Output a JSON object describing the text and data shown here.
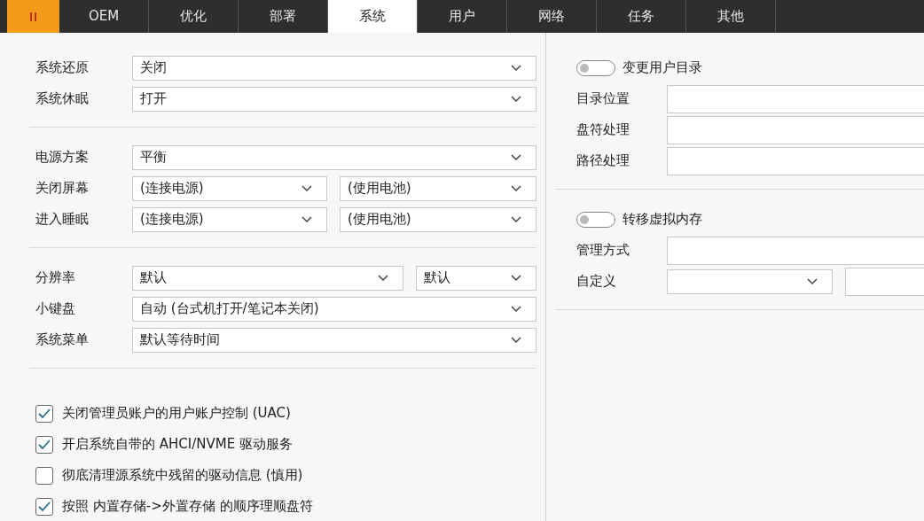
{
  "tabs": [
    {
      "kind": "pause",
      "selected": false
    },
    {
      "kind": "text",
      "label": "OEM",
      "selected": false
    },
    {
      "kind": "text",
      "label": "优化",
      "selected": false
    },
    {
      "kind": "text",
      "label": "部署",
      "selected": false
    },
    {
      "kind": "text",
      "label": "系统",
      "selected": true
    },
    {
      "kind": "text",
      "label": "用户",
      "selected": false
    },
    {
      "kind": "text",
      "label": "网络",
      "selected": false
    },
    {
      "kind": "text",
      "label": "任务",
      "selected": false
    },
    {
      "kind": "text",
      "label": "其他",
      "selected": false
    }
  ],
  "left_sections": [
    {
      "rows": [
        {
          "label": "系统还原",
          "kind": "single",
          "controls": [
            {
              "kind": "select",
              "value": "关闭"
            }
          ]
        },
        {
          "label": "系统休眠",
          "kind": "single",
          "controls": [
            {
              "kind": "select",
              "value": "打开"
            }
          ]
        }
      ]
    },
    {
      "rows": [
        {
          "label": "电源方案",
          "kind": "single",
          "controls": [
            {
              "kind": "select",
              "value": "平衡"
            }
          ]
        },
        {
          "label": "关闭屏幕",
          "kind": "pair",
          "controls": [
            {
              "kind": "select",
              "value": "(连接电源)"
            },
            {
              "kind": "select",
              "value": "(使用电池)"
            }
          ]
        },
        {
          "label": "进入睡眠",
          "kind": "pair",
          "controls": [
            {
              "kind": "select",
              "value": "(连接电源)"
            },
            {
              "kind": "select",
              "value": "(使用电池)"
            }
          ]
        }
      ]
    },
    {
      "rows": [
        {
          "label": "分辨率",
          "kind": "split",
          "controls": [
            {
              "kind": "select",
              "value": "默认"
            },
            {
              "kind": "select",
              "value": "默认"
            }
          ]
        },
        {
          "label": "小键盘",
          "kind": "single",
          "controls": [
            {
              "kind": "select",
              "value": "自动 (台式机打开/笔记本关闭)"
            }
          ]
        },
        {
          "label": "系统菜单",
          "kind": "single",
          "controls": [
            {
              "kind": "select",
              "value": "默认等待时间"
            }
          ]
        }
      ]
    }
  ],
  "checkboxes": [
    {
      "label": "关闭管理员账户的用户账户控制 (UAC)",
      "checked": true
    },
    {
      "label": "开启系统自带的 AHCI/NVME 驱动服务",
      "checked": true
    },
    {
      "label": "彻底清理源系统中残留的驱动信息 (慎用)",
      "checked": false
    },
    {
      "label": "按照 内置存储->外置存储 的顺序理顺盘符",
      "checked": true
    }
  ],
  "right_sections": [
    {
      "toggle": {
        "label": "变更用户目录",
        "on": false
      },
      "rows": [
        {
          "label": "目录位置",
          "kind": "single",
          "controls": [
            {
              "kind": "input"
            }
          ]
        },
        {
          "label": "盘符处理",
          "kind": "single",
          "controls": [
            {
              "kind": "input"
            }
          ]
        },
        {
          "label": "路径处理",
          "kind": "single",
          "controls": [
            {
              "kind": "input"
            }
          ]
        }
      ]
    },
    {
      "toggle": {
        "label": "转移虚拟内存",
        "on": false
      },
      "rows": [
        {
          "label": "管理方式",
          "kind": "single",
          "controls": [
            {
              "kind": "input"
            }
          ]
        },
        {
          "label": "自定义",
          "kind": "custom",
          "controls": [
            {
              "kind": "select"
            },
            {
              "kind": "input"
            }
          ]
        }
      ]
    }
  ]
}
